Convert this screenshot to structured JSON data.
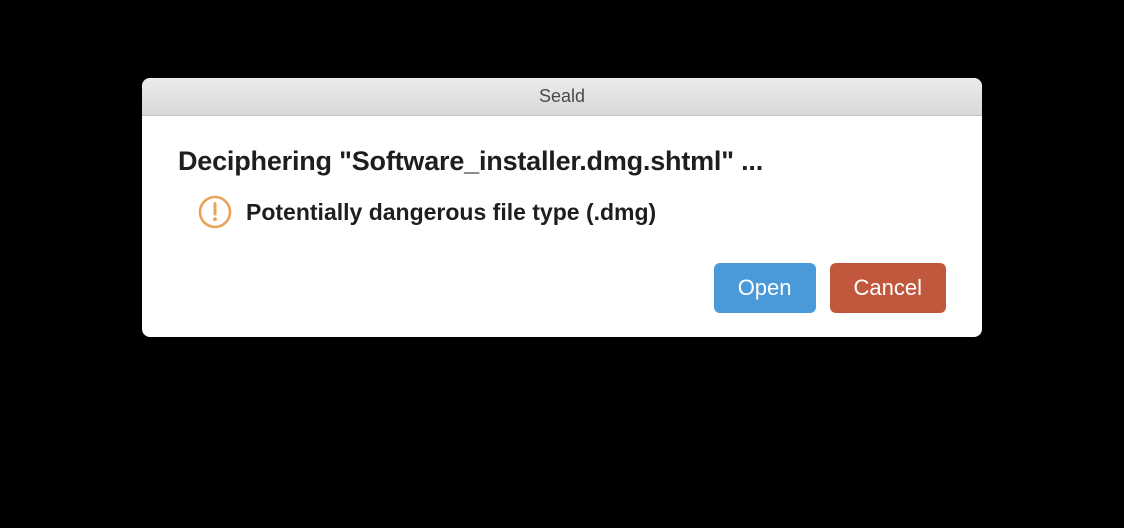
{
  "titlebar": {
    "title": "Seald"
  },
  "main": {
    "heading": "Deciphering \"Software_installer.dmg.shtml\" ...",
    "warning_text": "Potentially dangerous file type (.dmg)"
  },
  "buttons": {
    "open_label": "Open",
    "cancel_label": "Cancel"
  },
  "colors": {
    "open_button": "#4a99d8",
    "cancel_button": "#c1583e",
    "warning_accent": "#e9a35a"
  }
}
